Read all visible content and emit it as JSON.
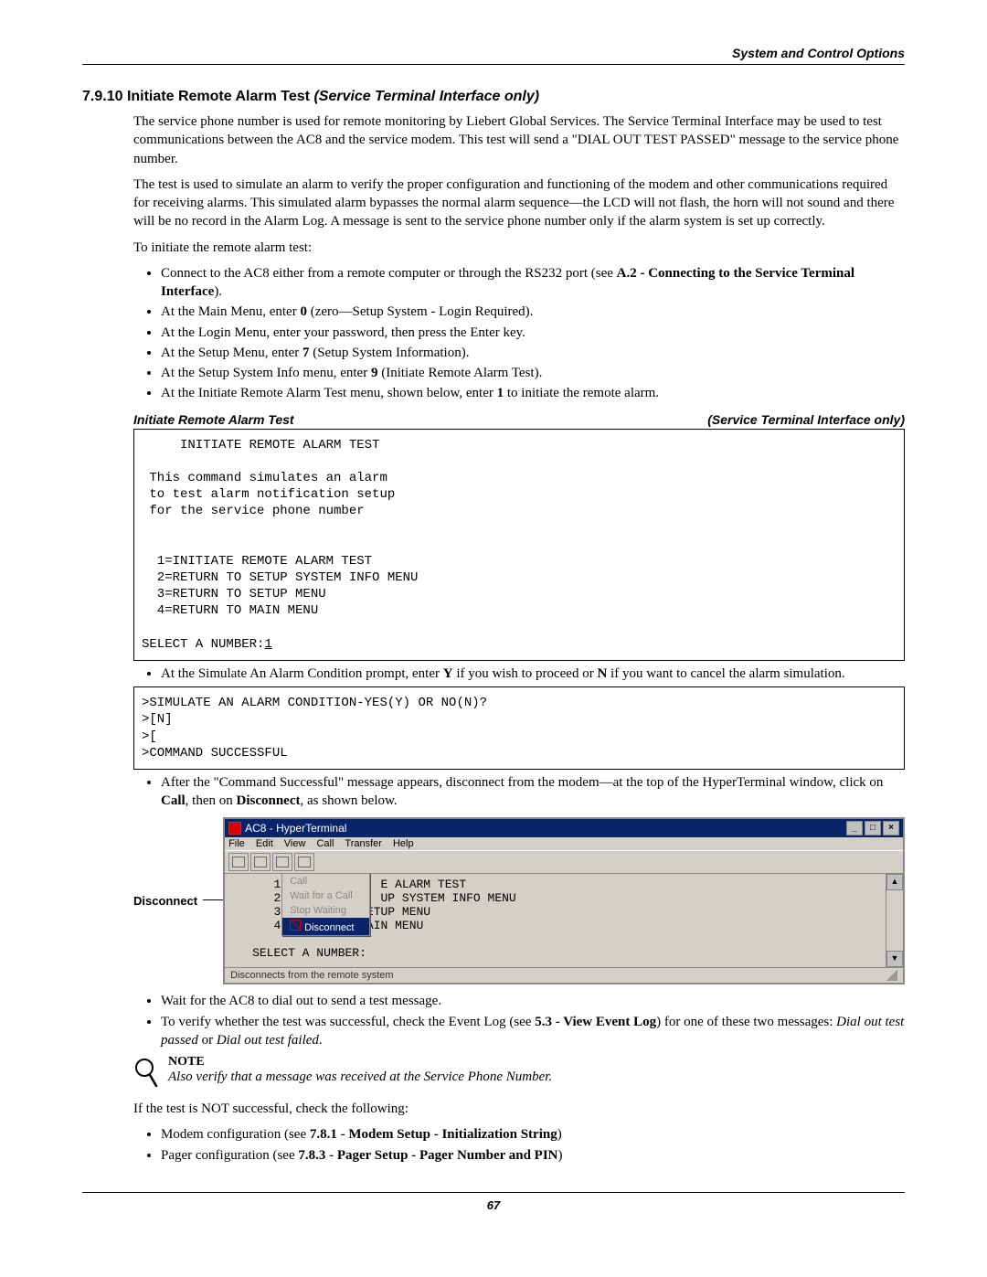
{
  "header": {
    "right": "System and Control Options"
  },
  "section": {
    "number": "7.9.10",
    "title": "Initiate Remote Alarm Test",
    "subtitle": "(Service Terminal Interface only)"
  },
  "para1": "The service phone number is used for remote monitoring by Liebert Global Services. The Service Terminal Interface may be used to test communications between the AC8 and the service modem. This test will send a \"DIAL OUT TEST PASSED\" message to the service phone number.",
  "para2": "The test is used to simulate an alarm to verify the proper configuration and functioning of the modem and other communications required for receiving alarms. This simulated alarm bypasses the normal alarm sequence—the LCD will not flash, the horn will not sound and there will be no record in the Alarm Log. A message is sent to the service phone number only if the alarm system is set up correctly.",
  "para3": "To initiate the remote alarm test:",
  "steps_a": {
    "s1a": "Connect to the AC8 either from a remote computer or through the RS232 port (see ",
    "s1b": "A.2 - Connecting to the Service Terminal Interface",
    "s1c": ").",
    "s2a": "At the Main Menu, enter ",
    "s2b": "0",
    "s2c": " (zero—Setup System - Login Required).",
    "s3": "At the Login Menu, enter your password, then press the Enter key.",
    "s4a": "At the Setup Menu, enter ",
    "s4b": "7",
    "s4c": " (Setup System Information).",
    "s5a": "At the Setup System Info menu, enter ",
    "s5b": "9",
    "s5c": " (Initiate Remote Alarm Test).",
    "s6a": "At the Initiate Remote Alarm Test menu, shown below, enter ",
    "s6b": "1",
    "s6c": " to initiate the remote alarm."
  },
  "code_header": {
    "left": "Initiate Remote Alarm Test",
    "right": "(Service Terminal Interface only)"
  },
  "code1": {
    "l1": "     INITIATE REMOTE ALARM TEST",
    "l2": "",
    "l3": " This command simulates an alarm",
    "l4": " to test alarm notification setup",
    "l5": " for the service phone number",
    "l6": "",
    "l7": "",
    "l8": "  1=INITIATE REMOTE ALARM TEST",
    "l9": "  2=RETURN TO SETUP SYSTEM INFO MENU",
    "l10": "  3=RETURN TO SETUP MENU",
    "l11": "  4=RETURN TO MAIN MENU",
    "l12": "",
    "l13": "SELECT A NUMBER:",
    "l13v": "1"
  },
  "mid1": {
    "a": "At the Simulate An Alarm Condition prompt, enter ",
    "b": "Y",
    "c": " if you wish to proceed or ",
    "d": "N",
    "e": " if you want to cancel the alarm simulation."
  },
  "code2": ">SIMULATE AN ALARM CONDITION-YES(Y) OR NO(N)?\n>[N]\n>[\n>COMMAND SUCCESSFUL",
  "mid2": {
    "a": "After the \"Command Successful\" message appears, disconnect from the modem—at the top of the HyperTerminal window, click on ",
    "b": "Call",
    "c": ", then on ",
    "d": "Disconnect",
    "e": ", as shown below."
  },
  "disconnect_label": "Disconnect",
  "hyperterm": {
    "title": "AC8 - HyperTerminal",
    "menu": [
      "File",
      "Edit",
      "View",
      "Call",
      "Transfer",
      "Help"
    ],
    "submenu": {
      "i1": "Call",
      "i2": "Wait for a Call",
      "i3": "Stop Waiting",
      "i4": "Disconnect"
    },
    "term": "   1=IN           E ALARM TEST\n   2=RE           UP SYSTEM INFO MENU\n   3=RETURN TO SETUP MENU\n   4=RETURN TO MAIN MENU\n\nSELECT A NUMBER:",
    "status": "Disconnects from the remote system"
  },
  "tail": {
    "t1": "Wait for the AC8 to dial out to send a test message.",
    "t2a": "To verify whether the test was successful, check the Event Log (see ",
    "t2b": "5.3 - View Event Log",
    "t2c": ") for one of these two messages: ",
    "t2d": "Dial out test passed",
    "t2e": " or ",
    "t2f": "Dial out test failed",
    "t2g": "."
  },
  "note": {
    "head": "NOTE",
    "body": "Also verify that a message was received at the Service Phone Number."
  },
  "after_note": "If the test is NOT successful, check the following:",
  "final": {
    "f1a": "Modem configuration (see ",
    "f1b": "7.8.1 - Modem Setup - Initialization String",
    "f1c": ")",
    "f2a": "Pager configuration (see ",
    "f2b": "7.8.3 - Pager Setup - Pager Number and PIN",
    "f2c": ")"
  },
  "page_number": "67"
}
